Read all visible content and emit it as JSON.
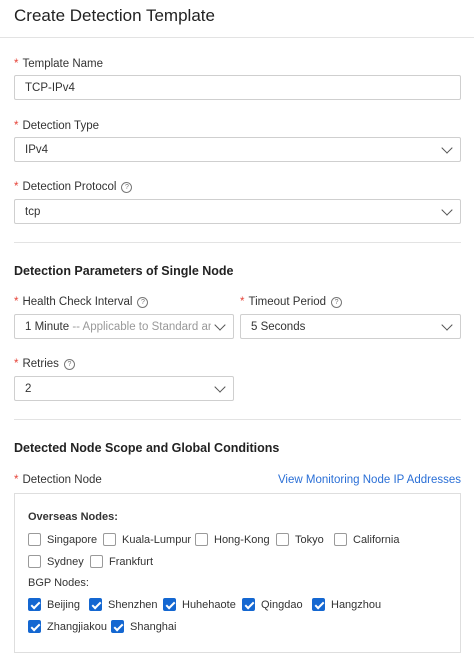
{
  "title": "Create Detection Template",
  "template_name": {
    "label": "Template Name",
    "value": "TCP-IPv4"
  },
  "detection_type": {
    "label": "Detection Type",
    "value": "IPv4"
  },
  "detection_protocol": {
    "label": "Detection Protocol",
    "value": "tcp"
  },
  "single_node": {
    "heading": "Detection Parameters of Single Node",
    "health_check": {
      "label": "Health Check Interval",
      "value": "1 Minute",
      "hint": "-- Applicable to Standard and Ultim"
    },
    "timeout": {
      "label": "Timeout Period",
      "value": "5 Seconds"
    },
    "retries": {
      "label": "Retries",
      "value": "2"
    }
  },
  "scope": {
    "heading": "Detected Node Scope and Global Conditions",
    "detection_node_label": "Detection Node",
    "link": "View Monitoring Node IP Addresses",
    "overseas_label": "Overseas Nodes:",
    "overseas": [
      {
        "name": "Singapore",
        "checked": false
      },
      {
        "name": "Kuala-Lumpur",
        "checked": false
      },
      {
        "name": "Hong-Kong",
        "checked": false
      },
      {
        "name": "Tokyo",
        "checked": false
      },
      {
        "name": "California",
        "checked": false
      },
      {
        "name": "Sydney",
        "checked": false
      },
      {
        "name": "Frankfurt",
        "checked": false
      }
    ],
    "bgp_label": "BGP Nodes:",
    "bgp": [
      {
        "name": "Beijing",
        "checked": true
      },
      {
        "name": "Shenzhen",
        "checked": true
      },
      {
        "name": "Huhehaote",
        "checked": true
      },
      {
        "name": "Qingdao",
        "checked": true
      },
      {
        "name": "Hangzhou",
        "checked": true
      },
      {
        "name": "Zhangjiakou",
        "checked": true
      },
      {
        "name": "Shanghai",
        "checked": true
      }
    ]
  },
  "required_mark": "*",
  "help_icon": "?",
  "colors": {
    "accent": "#1467d1",
    "link": "#2a6fd6",
    "required": "#e6443a"
  }
}
